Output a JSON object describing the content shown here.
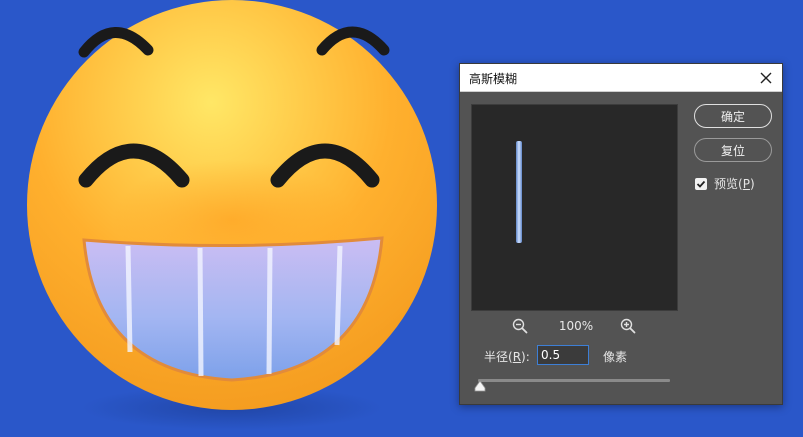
{
  "dialog": {
    "title": "高斯模糊",
    "ok_label": "确定",
    "reset_label": "复位",
    "preview_label": "预览(",
    "preview_hotkey": "P",
    "preview_suffix": ")",
    "preview_checked": true,
    "zoom_level": "100%",
    "radius_label_prefix": "半径(",
    "radius_hotkey": "R",
    "radius_label_suffix": "):",
    "radius_value": "0.5",
    "unit": "像素",
    "slider_fraction": 0.0
  },
  "icons": {
    "close": "close-icon",
    "zoom_out": "zoom-out-icon",
    "zoom_in": "zoom-in-icon",
    "slider_thumb": "triangle-thumb-icon"
  },
  "colors": {
    "background": "#2a57c9",
    "dialog_bg": "#535353",
    "preview_bg": "#282828",
    "input_border": "#3d7fd6"
  }
}
